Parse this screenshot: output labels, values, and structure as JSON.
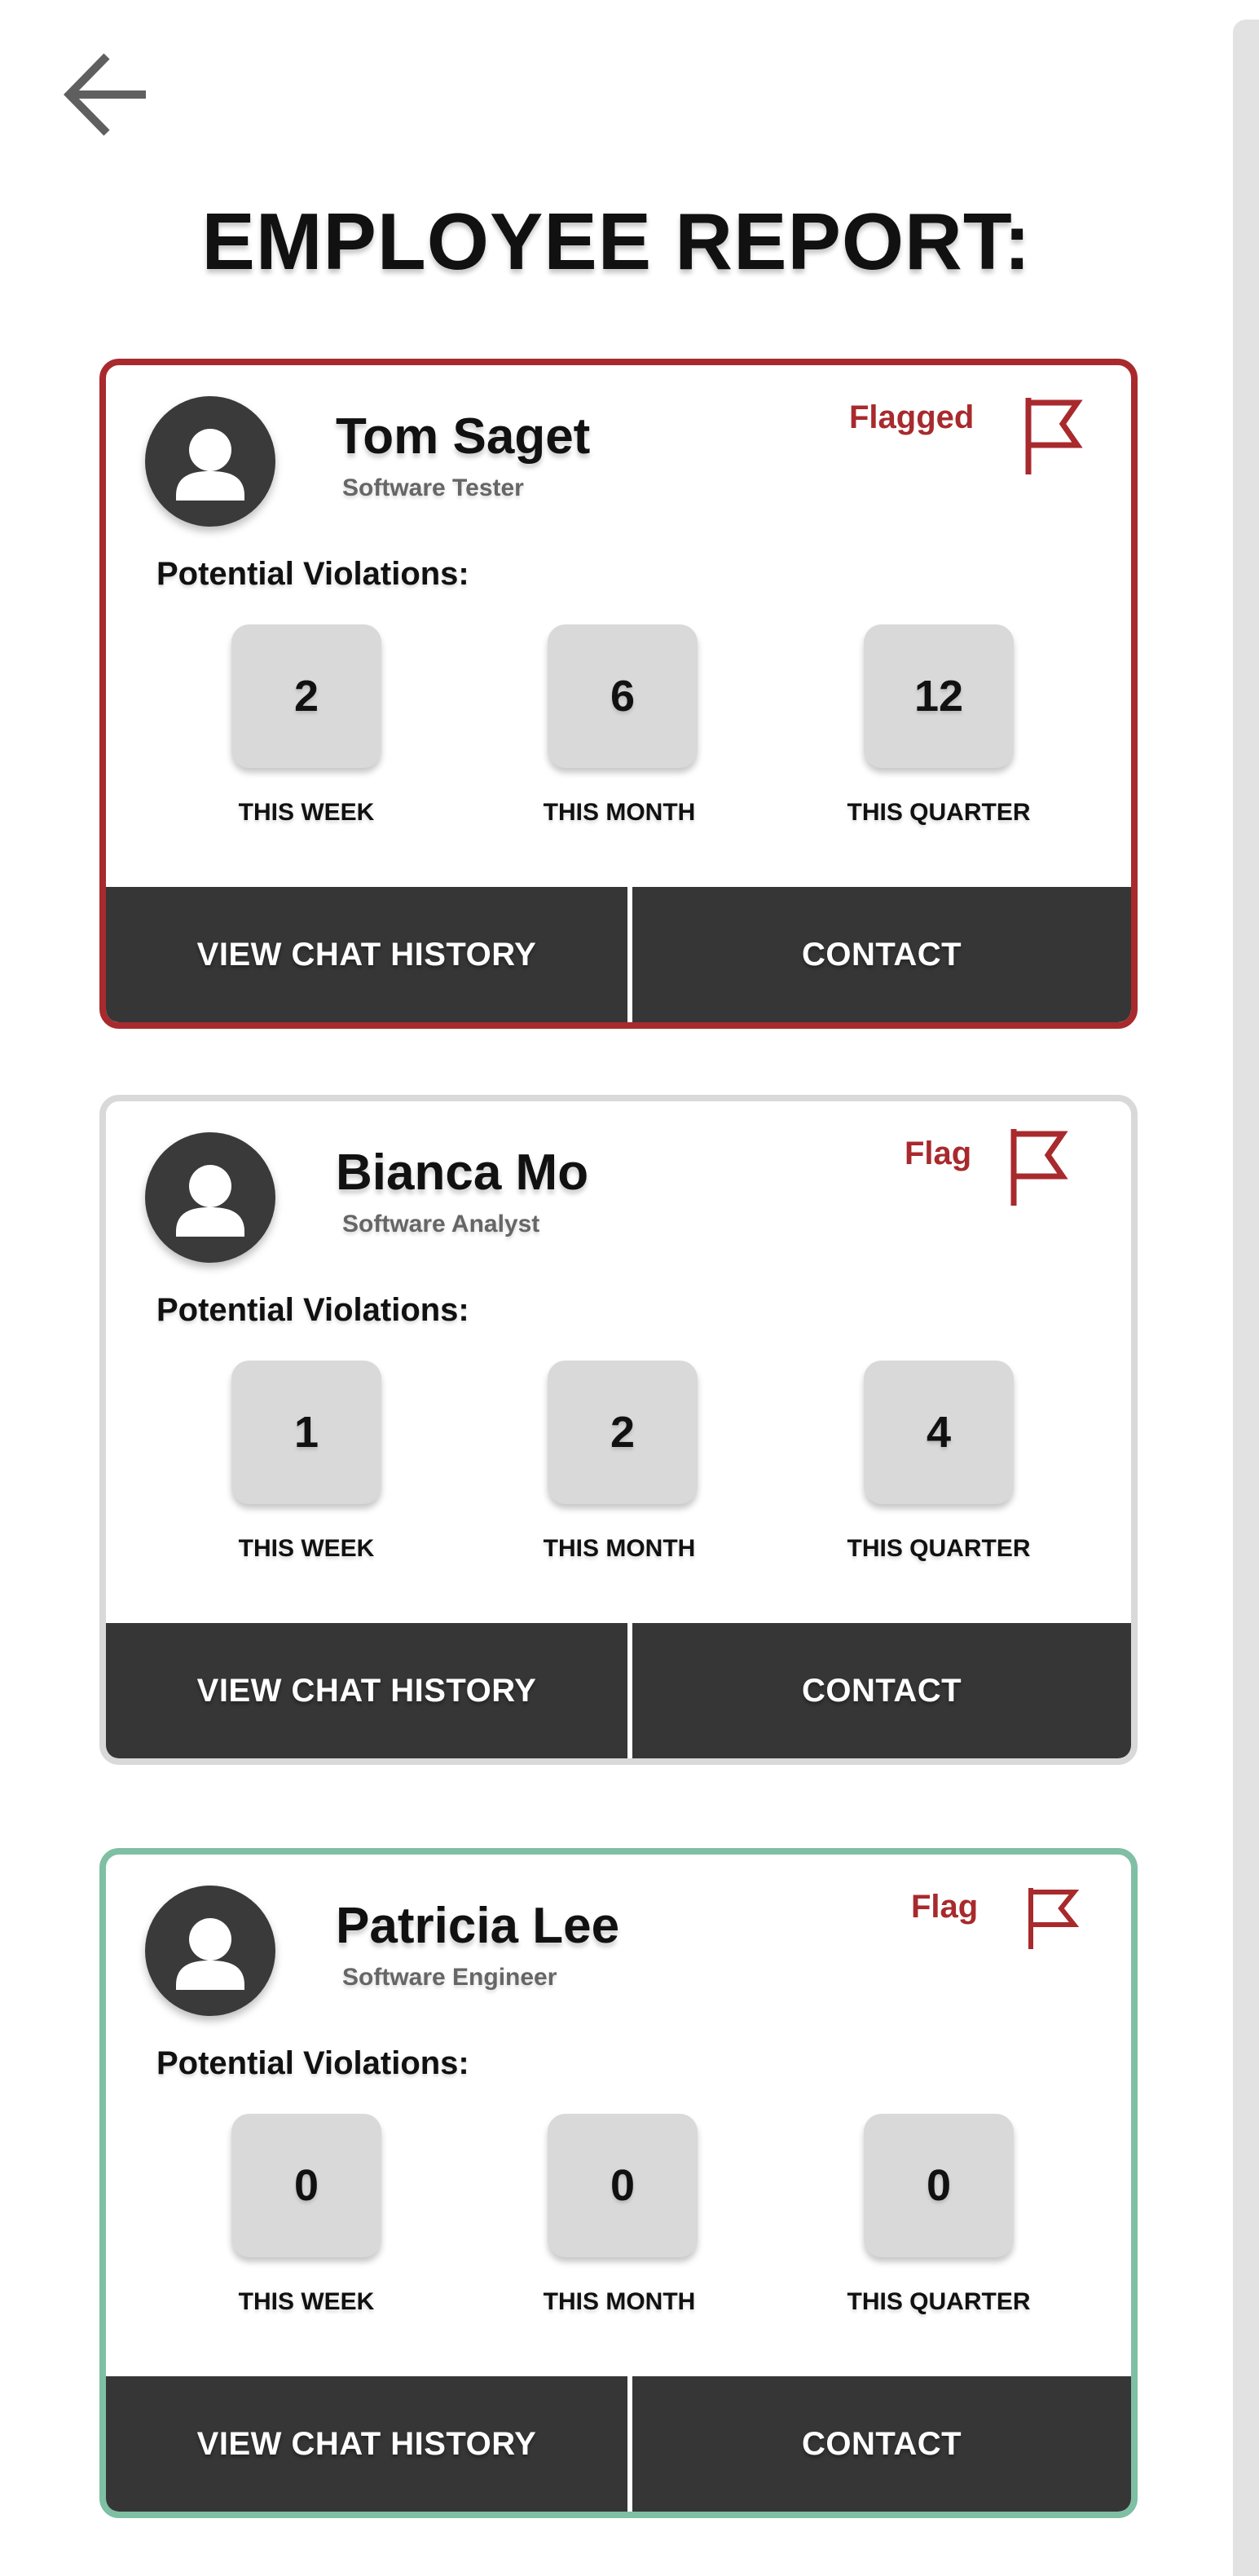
{
  "header": {
    "back_icon": "arrow-left-icon",
    "title": "EMPLOYEE REPORT:"
  },
  "colors": {
    "flagged_border": "#a82a2d",
    "neutral_border": "#d9d9d9",
    "clear_border": "#7fbfa4",
    "flag_red": "#a82a2d",
    "button_dark": "#363636",
    "stat_box": "#d9d9d9"
  },
  "violations_title": "Potential Violations:",
  "stat_labels": {
    "week": "THIS WEEK",
    "month": "THIS MONTH",
    "quarter": "THIS QUARTER"
  },
  "buttons": {
    "view_chat": "VIEW CHAT HISTORY",
    "contact": "CONTACT"
  },
  "employees": [
    {
      "name": "Tom Saget",
      "role": "Software Tester",
      "flag_label": "Flagged",
      "flag_icon": "flag-icon",
      "status": "flagged",
      "violations": {
        "week": "2",
        "month": "6",
        "quarter": "12"
      }
    },
    {
      "name": "Bianca Mo",
      "role": "Software Analyst",
      "flag_label": "Flag",
      "flag_icon": "flag-icon",
      "status": "neutral",
      "violations": {
        "week": "1",
        "month": "2",
        "quarter": "4"
      }
    },
    {
      "name": "Patricia Lee",
      "role": "Software Engineer",
      "flag_label": "Flag",
      "flag_icon": "flag-icon",
      "status": "clear",
      "violations": {
        "week": "0",
        "month": "0",
        "quarter": "0"
      }
    }
  ]
}
